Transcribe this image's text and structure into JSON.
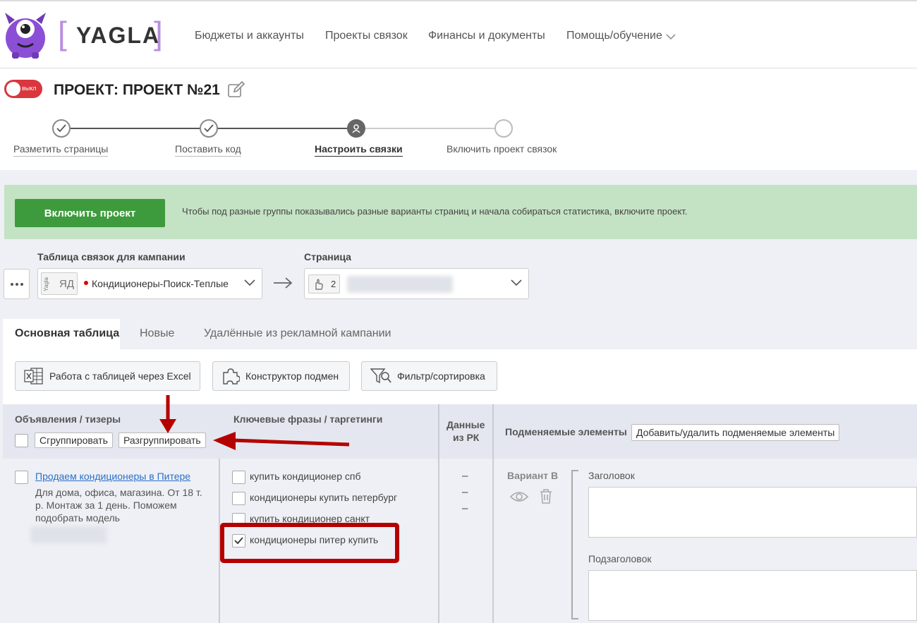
{
  "logo": {
    "text": "YAGLA",
    "bracket_left": "[",
    "bracket_right": "]"
  },
  "nav": [
    "Бюджеты и аккаунты",
    "Проекты связок",
    "Финансы и документы",
    "Помощь/обучение"
  ],
  "project": {
    "toggle_label": "выкл",
    "title": "ПРОЕКТ: ПРОЕКТ №21"
  },
  "steps": [
    {
      "label": "Разметить страницы",
      "state": "done"
    },
    {
      "label": "Поставить код",
      "state": "done"
    },
    {
      "label": "Настроить связки",
      "state": "current"
    },
    {
      "label": "Включить проект связок",
      "state": "todo"
    }
  ],
  "banner": {
    "button": "Включить проект",
    "text": "Чтобы под разные группы показывались разные варианты страниц и начала собираться статистика, включите проект."
  },
  "campaign": {
    "label": "Таблица связок для кампании",
    "badge_small": "Yagla",
    "badge": "ЯД",
    "value": "Кондиционеры-Поиск-Теплые"
  },
  "page": {
    "label": "Страница",
    "count": "2"
  },
  "tabs": [
    "Основная таблица",
    "Новые",
    "Удалённые из рекламной кампании"
  ],
  "tools": [
    "Работа с таблицей через Excel",
    "Конструктор подмен",
    "Фильтр/сортировка"
  ],
  "table": {
    "col_ads": "Объявления / тизеры",
    "col_keywords": "Ключевые фразы / таргетинги",
    "col_data_1": "Данные",
    "col_data_2": "из РК",
    "col_replace": "Подменяемые элементы",
    "btn_replace": "Добавить/удалить подменяемые элементы",
    "btn_group": "Сгруппировать",
    "btn_ungroup": "Разгруппировать"
  },
  "ad": {
    "title": "Продаем кондиционеры в Питере",
    "text_1": "Для дома, офиса, магазина. От 18 т.",
    "text_2": "р. Монтаж за 1 день. Поможем",
    "text_3": "подобрать модель"
  },
  "keywords": [
    {
      "text": "купить кондиционер спб",
      "checked": false
    },
    {
      "text": "кондиционеры купить петербург",
      "checked": false
    },
    {
      "text": "купить кондиционер санкт",
      "checked": false
    },
    {
      "text": "кондиционеры питер купить",
      "checked": true
    }
  ],
  "data_values": [
    "–",
    "–",
    "–"
  ],
  "variant": {
    "label": "Вариант В",
    "field1": "Заголовок",
    "field2": "Подзаголовок"
  },
  "colors": {
    "green": "#3d9b3d",
    "red_annotation": "#b50000",
    "toggle_red": "#d9363e",
    "logo_purple": "#8b4fd6"
  }
}
